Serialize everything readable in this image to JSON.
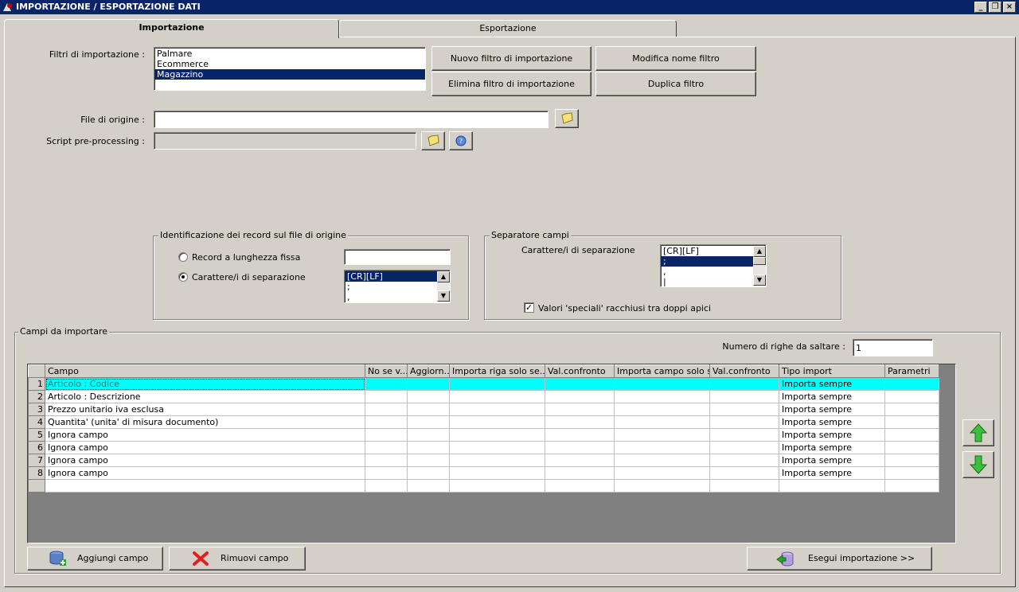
{
  "window": {
    "title": "IMPORTAZIONE / ESPORTAZIONE DATI"
  },
  "tabs": [
    {
      "label": "Importazione"
    },
    {
      "label": "Esportazione"
    }
  ],
  "filters": {
    "label": "Filtri di importazione :",
    "items": [
      "Palmare",
      "Ecommerce",
      "Magazzino"
    ],
    "selected": "Magazzino",
    "new_button": "Nuovo filtro di importazione",
    "rename_button": "Modifica nome filtro",
    "delete_button": "Elimina filtro di importazione",
    "duplicate_button": "Duplica filtro"
  },
  "source": {
    "label": "File di origine :",
    "value": ""
  },
  "script": {
    "label": "Script pre-processing :",
    "value": ""
  },
  "record_ident": {
    "title": "Identificazione dei record sul file di origine",
    "fixed_length_label": "Record a lunghezza fissa",
    "fixed_length_value": "",
    "separator_label": "Carattere/i di separazione",
    "separator_items": [
      "[CR][LF]",
      ";",
      ","
    ],
    "selected": "[CR][LF]"
  },
  "field_separator": {
    "title": "Separatore campi",
    "label": "Carattere/i di separazione",
    "items": [
      "[CR][LF]",
      ";",
      ",",
      "|"
    ],
    "selected": ";",
    "quotes_label": "Valori 'speciali' racchiusi tra doppi apici",
    "quotes_checked": true
  },
  "fields": {
    "title": "Campi da importare",
    "skip_rows_label": "Numero di righe da saltare :",
    "skip_rows_value": "1",
    "columns": [
      "Campo",
      "No se v...",
      "Aggiorn...",
      "Importa riga solo se...",
      "Val.confronto",
      "Importa campo solo s...",
      "Val.confronto",
      "Tipo import",
      "Parametri"
    ],
    "rows": [
      {
        "n": "1",
        "campo": "Articolo : Codice",
        "tipo": "Importa sempre"
      },
      {
        "n": "2",
        "campo": "Articolo : Descrizione",
        "tipo": "Importa sempre"
      },
      {
        "n": "3",
        "campo": "Prezzo unitario iva esclusa",
        "tipo": "Importa sempre"
      },
      {
        "n": "4",
        "campo": "Quantita' (unita' di misura documento)",
        "tipo": "Importa sempre"
      },
      {
        "n": "5",
        "campo": "Ignora campo",
        "tipo": "Importa sempre"
      },
      {
        "n": "6",
        "campo": "Ignora campo",
        "tipo": "Importa sempre"
      },
      {
        "n": "7",
        "campo": "Ignora campo",
        "tipo": "Importa sempre"
      },
      {
        "n": "8",
        "campo": "Ignora campo",
        "tipo": "Importa sempre"
      }
    ],
    "add_button": "Aggiungi campo",
    "remove_button": "Rimuovi campo",
    "run_button": "Esegui importazione >>"
  },
  "colors": {
    "title_bar": "#0a246a",
    "highlight_row": "#00ffff",
    "arrow": "#2ea82e",
    "remove": "#e02020"
  }
}
